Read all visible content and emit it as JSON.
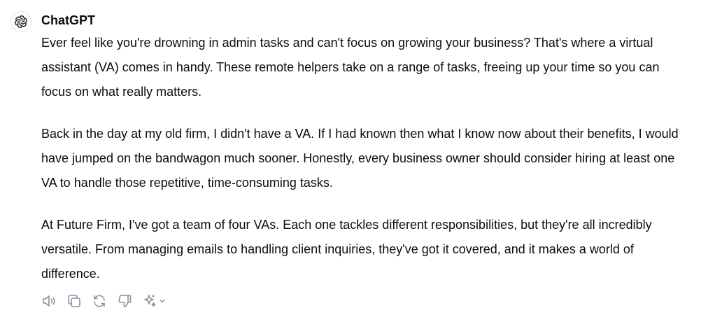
{
  "message": {
    "author": "ChatGPT",
    "paragraphs": [
      "Ever feel like you're drowning in admin tasks and can't focus on growing your business? That's where a virtual assistant (VA) comes in handy. These remote helpers take on a range of tasks, freeing up your time so you can focus on what really matters.",
      "Back in the day at my old firm, I didn't have a VA. If I had known then what I know now about their benefits, I would have jumped on the bandwagon much sooner. Honestly, every business owner should consider hiring at least one VA to handle those repetitive, time-consuming tasks.",
      "At Future Firm, I've got a team of four VAs. Each one tackles different responsibilities, but they're all incredibly versatile. From managing emails to handling client inquiries, they've got it covered, and it makes a world of difference."
    ]
  },
  "icons": {
    "avatar": "openai-logo-icon",
    "read_aloud": "speaker-icon",
    "copy": "copy-icon",
    "regenerate": "refresh-icon",
    "bad_response": "thumbs-down-icon",
    "change_model": "sparkle-icon"
  },
  "colors": {
    "text": "#0d0d0d",
    "icon": "#8e8ea0",
    "avatar_border": "#e3e3e3"
  }
}
